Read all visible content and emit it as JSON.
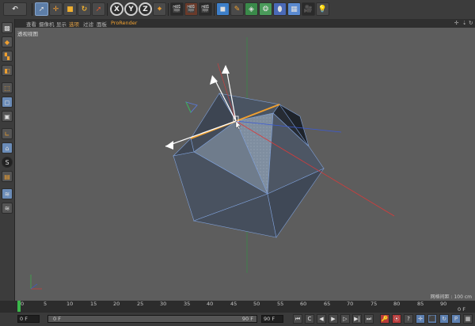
{
  "toolbar": {
    "undo_glyph": "↶",
    "axis_x": "X",
    "axis_y": "Y",
    "axis_z": "Z"
  },
  "viewport_menu": {
    "items": [
      "查看",
      "摄像机",
      "显示",
      "选项",
      "过滤",
      "面板",
      "ProRender"
    ],
    "highlighted_index": 3,
    "label": "透视视图",
    "grid_spacing": "网格间距 : 100 cm"
  },
  "timeline": {
    "ticks": [
      "0",
      "5",
      "10",
      "15",
      "20",
      "25",
      "30",
      "35",
      "40",
      "45",
      "50",
      "55",
      "60",
      "65",
      "70",
      "75",
      "80",
      "85",
      "90"
    ],
    "end_label": "0 F"
  },
  "bottom_bar": {
    "current_frame": "0 F",
    "range_start": "0 F",
    "range_end": "90 F",
    "max_frame": "90 F"
  },
  "colors": {
    "accent_active": "#5d7ea8",
    "axis_x": "#d83a3a",
    "axis_y": "#3ab84a",
    "axis_z": "#3a5ad8",
    "selection_edge": "#f0a030"
  }
}
